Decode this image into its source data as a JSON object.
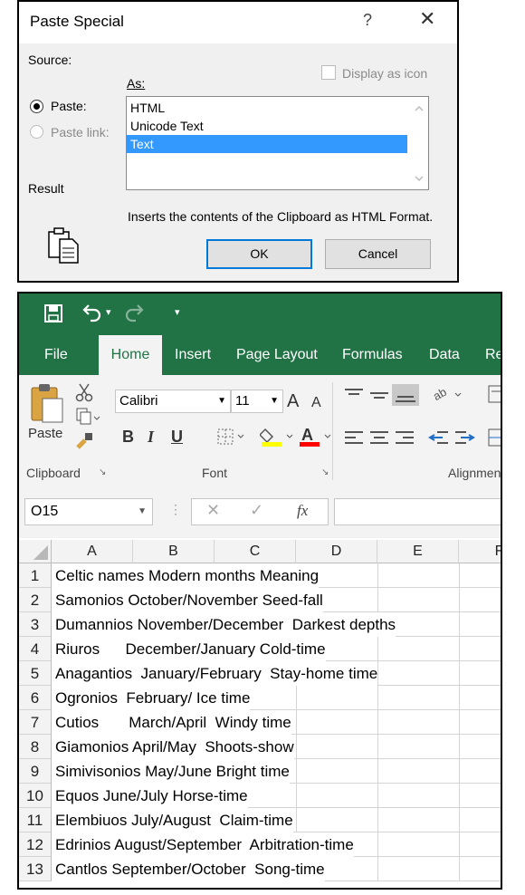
{
  "dialog": {
    "title": "Paste Special",
    "help": "?",
    "close": "✕",
    "source_label": "Source:",
    "as_label": "As:",
    "display_as_icon": "Display as icon",
    "paste_label": "Paste:",
    "paste_link_label": "Paste link:",
    "as_options": [
      "HTML",
      "Unicode Text",
      "Text"
    ],
    "selected_option": "Text",
    "result_label": "Result",
    "result_text": "Inserts the contents of the Clipboard as HTML Format.",
    "ok_label": "OK",
    "cancel_label": "Cancel"
  },
  "excel": {
    "qat": {
      "undo_arrow": "▾",
      "customize": "▾"
    },
    "tabs": [
      "File",
      "Home",
      "Insert",
      "Page Layout",
      "Formulas",
      "Data",
      "Re"
    ],
    "active_tab": "Home",
    "ribbon": {
      "clipboard_group": "Clipboard",
      "paste_label": "Paste",
      "font_group": "Font",
      "font_name": "Calibri",
      "font_size": "11",
      "alignment_group": "Alignmen",
      "bold": "B",
      "italic": "I",
      "underline": "U",
      "font_color_letter": "A",
      "grow_font": "A",
      "shrink_font": "A"
    },
    "name_box": "O15",
    "fx": "fx",
    "columns": [
      "A",
      "B",
      "C",
      "D",
      "E",
      "F"
    ],
    "rows": [
      {
        "num": "1",
        "text": "Celtic names Modern months Meaning"
      },
      {
        "num": "2",
        "text": "Samonios October/November Seed-fall"
      },
      {
        "num": "3",
        "text": "Dumannios November/December  Darkest depths"
      },
      {
        "num": "4",
        "text": "Riuros      December/January Cold-time"
      },
      {
        "num": "5",
        "text": "Anagantios  January/February  Stay-home time"
      },
      {
        "num": "6",
        "text": "Ogronios  February/ Ice time"
      },
      {
        "num": "7",
        "text": "Cutios       March/April  Windy time"
      },
      {
        "num": "8",
        "text": "Giamonios April/May  Shoots-show"
      },
      {
        "num": "9",
        "text": "Simivisonios May/June Bright time"
      },
      {
        "num": "10",
        "text": "Equos June/July Horse-time"
      },
      {
        "num": "11",
        "text": "Elembiuos July/August  Claim-time"
      },
      {
        "num": "12",
        "text": "Edrinios August/September  Arbitration-time"
      },
      {
        "num": "13",
        "text": "Cantlos September/October  Song-time"
      }
    ]
  }
}
